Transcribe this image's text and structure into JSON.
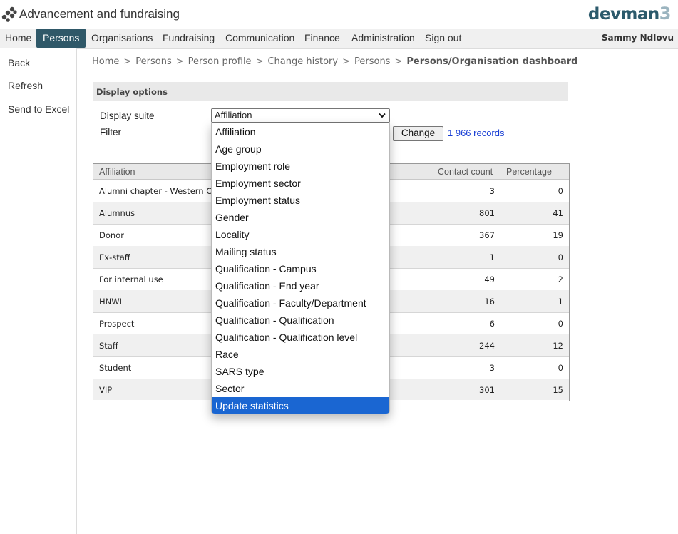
{
  "header": {
    "app_title": "Advancement and fundraising",
    "brand": "devman",
    "brand_suffix": "3",
    "brand_color": "#2c5a6c"
  },
  "nav": {
    "items": [
      "Home",
      "Persons",
      "Organisations",
      "Fundraising",
      "Communication",
      "Finance",
      "Administration",
      "Sign out"
    ],
    "active": "Persons",
    "active_color": "#2f5868",
    "user": "Sammy Ndlovu"
  },
  "sidebar": {
    "items": [
      "Back",
      "Refresh",
      "Send to Excel"
    ]
  },
  "breadcrumb": {
    "items": [
      "Home",
      "Persons",
      "Person profile",
      "Change history",
      "Persons"
    ],
    "separator": ">",
    "current": "Persons/Organisation dashboard"
  },
  "display_options": {
    "title": "Display options",
    "suite_label": "Display suite",
    "suite_value": "Affiliation",
    "filter_label": "Filter",
    "change_label": "Change",
    "records": "1 966 records"
  },
  "table": {
    "columns": [
      "Affiliation",
      "Contact count",
      "Percentage"
    ],
    "rows": [
      [
        "Alumni chapter - Western Ca",
        "3",
        "0"
      ],
      [
        "Alumnus",
        "801",
        "41"
      ],
      [
        "Donor",
        "367",
        "19"
      ],
      [
        "Ex-staff",
        "1",
        "0"
      ],
      [
        "For internal use",
        "49",
        "2"
      ],
      [
        "HNWI",
        "16",
        "1"
      ],
      [
        "Prospect",
        "6",
        "0"
      ],
      [
        "Staff",
        "244",
        "12"
      ],
      [
        "Student",
        "3",
        "0"
      ],
      [
        "VIP",
        "301",
        "15"
      ]
    ]
  },
  "dropdown": {
    "options": [
      "Affiliation",
      "Age group",
      "Employment role",
      "Employment sector",
      "Employment status",
      "Gender",
      "Locality",
      "Mailing status",
      "Qualification - Campus",
      "Qualification - End year",
      "Qualification - Faculty/Department",
      "Qualification - Qualification",
      "Qualification - Qualification level",
      "Race",
      "SARS type",
      "Sector",
      "Update statistics"
    ],
    "highlighted": "Update statistics",
    "highlight_color": "#1a66d2"
  }
}
